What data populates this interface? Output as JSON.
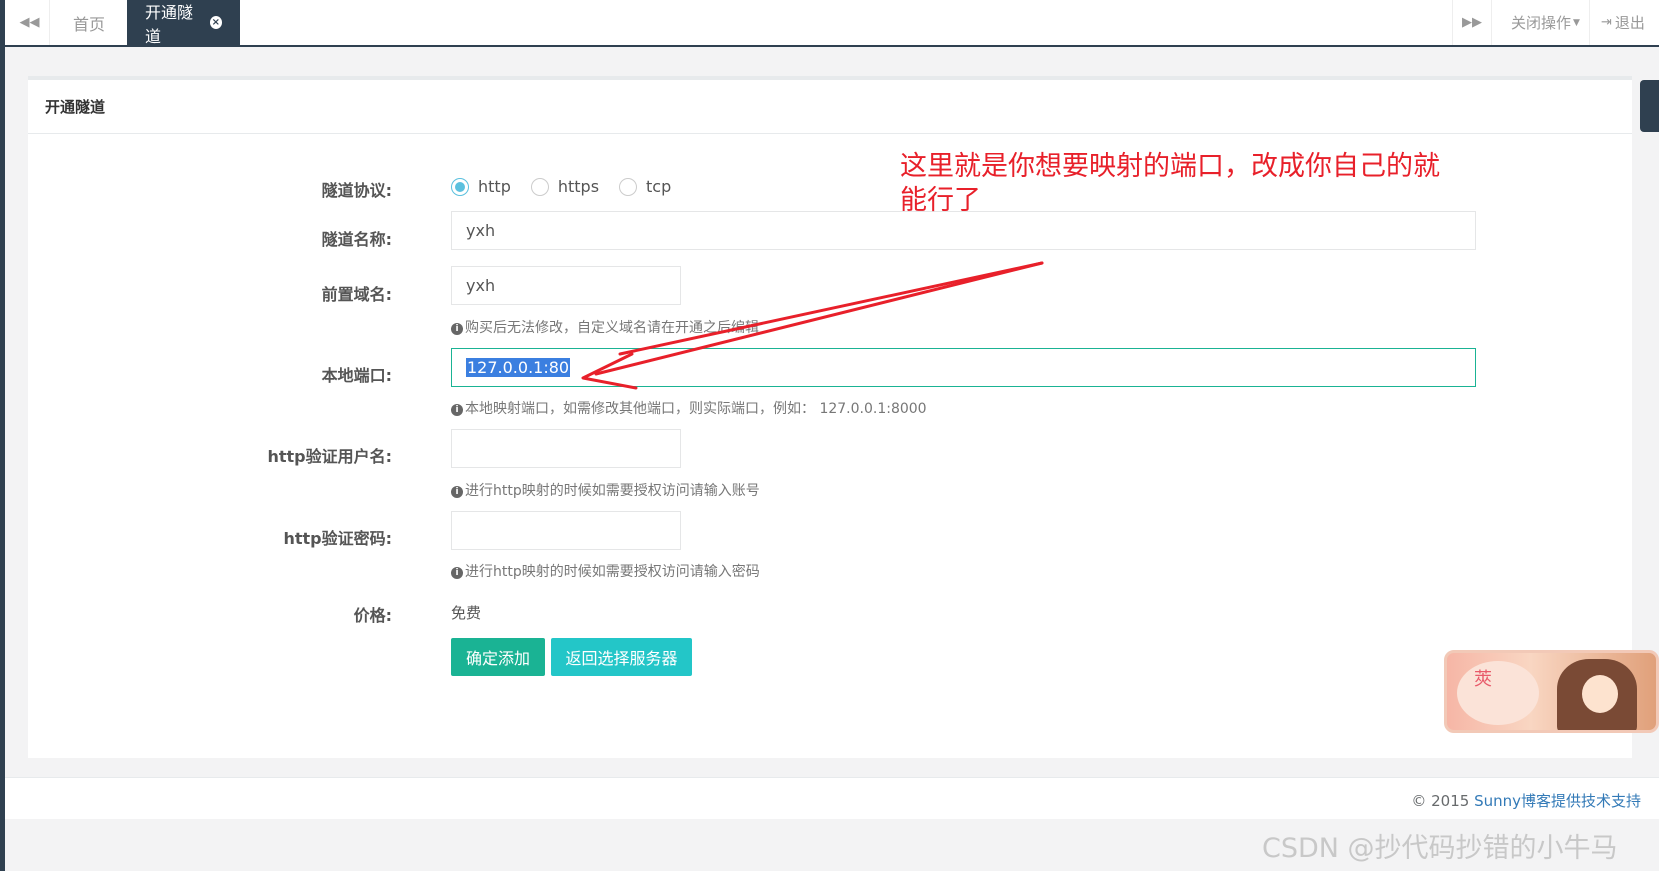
{
  "tabs": {
    "home_label": "首页",
    "active_label": "开通隧道",
    "close_ops_label": "关闭操作",
    "logout_label": "退出"
  },
  "panel": {
    "title": "开通隧道"
  },
  "form": {
    "protocol_label": "隧道协议:",
    "protocol_options": [
      "http",
      "https",
      "tcp"
    ],
    "protocol_selected": "http",
    "name_label": "隧道名称:",
    "name_value": "yxh",
    "prefix_label": "前置域名:",
    "prefix_value": "yxh",
    "prefix_help": "购买后无法修改，自定义域名请在开通之后编辑",
    "port_label": "本地端口:",
    "port_value": "127.0.0.1:80",
    "port_help": "本地映射端口，如需修改其他端口，则实际端口，例如： 127.0.0.1:8000",
    "user_label": "http验证用户名:",
    "user_value": "",
    "user_help": "进行http映射的时候如需要授权访问请输入账号",
    "pwd_label": "http验证密码:",
    "pwd_value": "",
    "pwd_help": "进行http映射的时候如需要授权访问请输入密码",
    "price_label": "价格:",
    "price_value": "免费",
    "submit_label": "确定添加",
    "back_label": "返回选择服务器"
  },
  "annotation": {
    "text": "这里就是你想要映射的端口，改成你自己的就能行了",
    "color": "#e8202a"
  },
  "footer": {
    "copyright": "© 2015 ",
    "link_text": "Sunny博客提供技术支持"
  },
  "sticker_text": "莢",
  "watermark": "CSDN @抄代码抄错的小牛马",
  "colors": {
    "nav_dark": "#2f4050",
    "primary": "#1ab394",
    "info": "#23c6c8",
    "radio_checked": "#5bc0de"
  }
}
